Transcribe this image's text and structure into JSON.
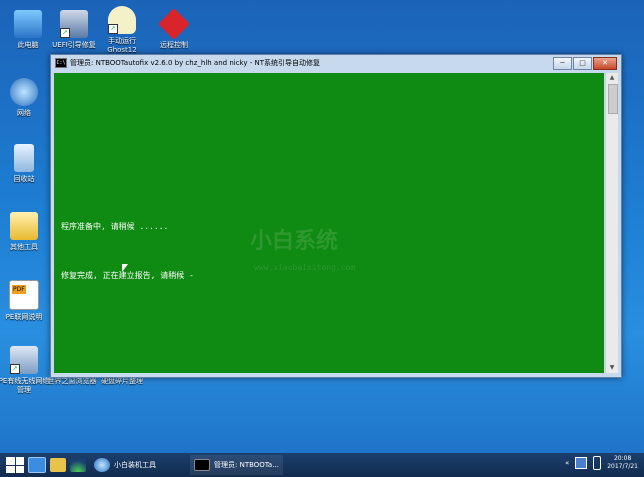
{
  "desktop": {
    "icons": [
      {
        "label": "此电脑"
      },
      {
        "label": "UEFI引导修复"
      },
      {
        "label": "手动运行Ghost12"
      },
      {
        "label": "远程控制"
      },
      {
        "label": "网络"
      },
      {
        "label": "回收站"
      },
      {
        "label": "其他工具"
      },
      {
        "label": "PE联网说明"
      },
      {
        "label": "PE有线无线网络管理"
      },
      {
        "label": "世界之窗浏览器"
      },
      {
        "label": "硬盘碎片整理"
      }
    ],
    "watermark": {
      "brand": "小白系统",
      "url": "www.xiaobaixitong.com"
    }
  },
  "window": {
    "title": "管理员: NTBOOTautofix v2.6.0 by chz_hlh and nicky - NT系统引导自动修复",
    "minimize": "─",
    "maximize": "□",
    "close": "✕"
  },
  "console": {
    "line1": "程序准备中, 请稍候 ......",
    "line2": "修复完成, 正在建立报告, 请稍候 -"
  },
  "taskbar": {
    "app1_label": "小白装机工具",
    "app2_label": "管理员: NTBOOTa...",
    "time": "20:08",
    "date": "2017/7/21",
    "collapse": "«"
  },
  "colors": {
    "console_bg": "#0f8a12",
    "desktop_bg": "#1e7fd3",
    "taskbar": "#122b4d"
  }
}
